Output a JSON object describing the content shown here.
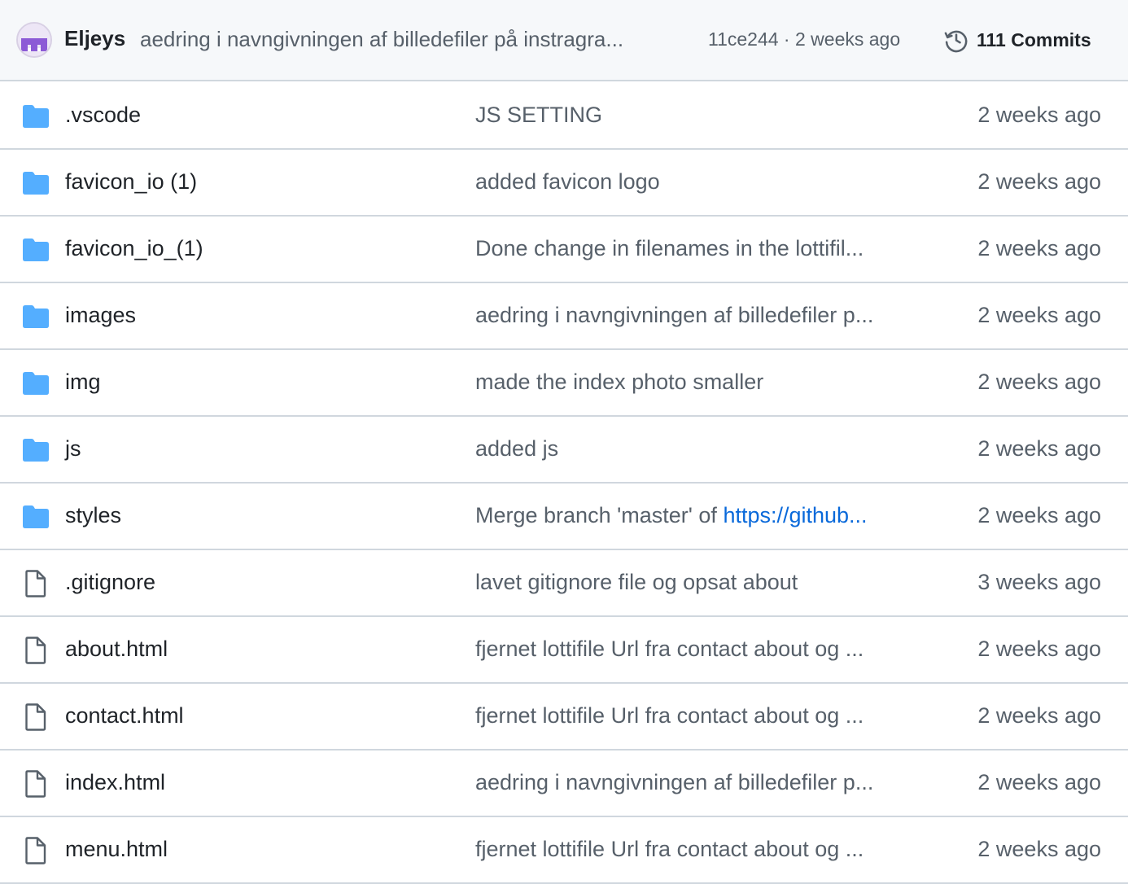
{
  "latest_commit": {
    "author": "Eljeys",
    "message": "aedring i navngivningen af billedefiler på instragra...",
    "sha": "11ce244",
    "separator": " · ",
    "time": "2 weeks ago",
    "commits_label": "111 Commits"
  },
  "files": [
    {
      "type": "folder",
      "name": ".vscode",
      "message": "JS SETTING",
      "time": "2 weeks ago"
    },
    {
      "type": "folder",
      "name": "favicon_io (1)",
      "message": "added favicon logo",
      "time": "2 weeks ago"
    },
    {
      "type": "folder",
      "name": "favicon_io_(1)",
      "message": "Done change in filenames in the lottifil...",
      "time": "2 weeks ago"
    },
    {
      "type": "folder",
      "name": "images",
      "message": "aedring i navngivningen af billedefiler p...",
      "time": "2 weeks ago"
    },
    {
      "type": "folder",
      "name": "img",
      "message": "made the index photo smaller",
      "time": "2 weeks ago"
    },
    {
      "type": "folder",
      "name": "js",
      "message": "added js",
      "time": "2 weeks ago"
    },
    {
      "type": "folder",
      "name": "styles",
      "message": "Merge branch 'master' of ",
      "message_link": "https://github...",
      "time": "2 weeks ago"
    },
    {
      "type": "file",
      "name": ".gitignore",
      "message": "lavet gitignore file og opsat about",
      "time": "3 weeks ago"
    },
    {
      "type": "file",
      "name": "about.html",
      "message": "fjernet lottifile Url fra contact about og ...",
      "time": "2 weeks ago"
    },
    {
      "type": "file",
      "name": "contact.html",
      "message": "fjernet lottifile Url fra contact about og ...",
      "time": "2 weeks ago"
    },
    {
      "type": "file",
      "name": "index.html",
      "message": "aedring i navngivningen af billedefiler p...",
      "time": "2 weeks ago"
    },
    {
      "type": "file",
      "name": "menu.html",
      "message": "fjernet lottifile Url fra contact about og ...",
      "time": "2 weeks ago"
    }
  ],
  "colors": {
    "folder_icon": "#54aeff",
    "file_icon": "#57606a",
    "link": "#0969da",
    "avatar_accent": "#8c5ad6"
  },
  "icons": {
    "folder": "folder-icon",
    "file": "file-icon",
    "history": "history-icon",
    "avatar": "avatar"
  }
}
